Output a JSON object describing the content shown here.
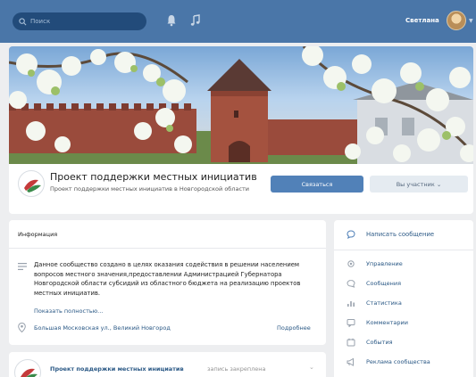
{
  "header": {
    "search_placeholder": "Поиск",
    "user_name": "Светлана",
    "icons": [
      "search-icon",
      "bell-icon",
      "music-icon",
      "chevron-down-icon"
    ],
    "brand_color": "#4a76a8"
  },
  "group": {
    "title": "Проект поддержки местных инициатив",
    "subtitle": "Проект поддержки местных инициатив в Новгородской области",
    "subscribe_label": "Связаться",
    "member_label": "Вы участник ⌄"
  },
  "info": {
    "title": "Информация",
    "description": "Данное сообщество создано в целях оказания содействия в решении населением вопросов местного значения,предоставлении Администрацией Губернатора Новгородской области субсидий из областного бюджета на реализацию проектов местных инициатив.",
    "show_more": "Показать полностью...",
    "address": "Большая Московская ул., Великий Новгород",
    "details": "Подробнее"
  },
  "post": {
    "author": "Проект поддержки местных инициатив",
    "pinned": "запись закреплена",
    "chevron": "⌄"
  },
  "menu": {
    "write_message": "Написать сообщение",
    "items": [
      {
        "label": "Управление",
        "icon": "gear-icon"
      },
      {
        "label": "Сообщения",
        "icon": "chat-icon"
      },
      {
        "label": "Статистика",
        "icon": "stats-icon"
      },
      {
        "label": "Комментарии",
        "icon": "comments-icon"
      },
      {
        "label": "События",
        "icon": "events-icon"
      },
      {
        "label": "Реклама сообщества",
        "icon": "megaphone-icon"
      }
    ]
  }
}
